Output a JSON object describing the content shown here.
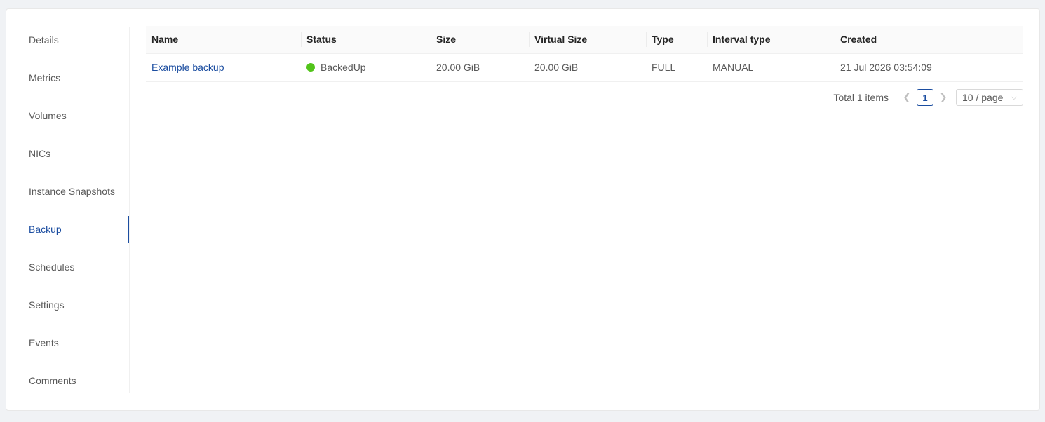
{
  "tabs": [
    {
      "label": "Details"
    },
    {
      "label": "Metrics"
    },
    {
      "label": "Volumes"
    },
    {
      "label": "NICs"
    },
    {
      "label": "Instance Snapshots"
    },
    {
      "label": "Backup"
    },
    {
      "label": "Schedules"
    },
    {
      "label": "Settings"
    },
    {
      "label": "Events"
    },
    {
      "label": "Comments"
    }
  ],
  "active_tab": "Backup",
  "table": {
    "columns": [
      "Name",
      "Status",
      "Size",
      "Virtual Size",
      "Type",
      "Interval type",
      "Created"
    ],
    "rows": [
      {
        "name": "Example backup",
        "status": "BackedUp",
        "size": "20.00 GiB",
        "virtual_size": "20.00 GiB",
        "type": "FULL",
        "interval_type": "MANUAL",
        "created": "21 Jul 2026 03:54:09"
      }
    ]
  },
  "pagination": {
    "total": "Total 1 items",
    "prev_icon": "chevron-left-icon",
    "next_icon": "chevron-right-icon",
    "current_page": "1",
    "page_size": "10 / page"
  },
  "colors": {
    "accent": "#1b4da0",
    "status_success": "#52c41a"
  }
}
